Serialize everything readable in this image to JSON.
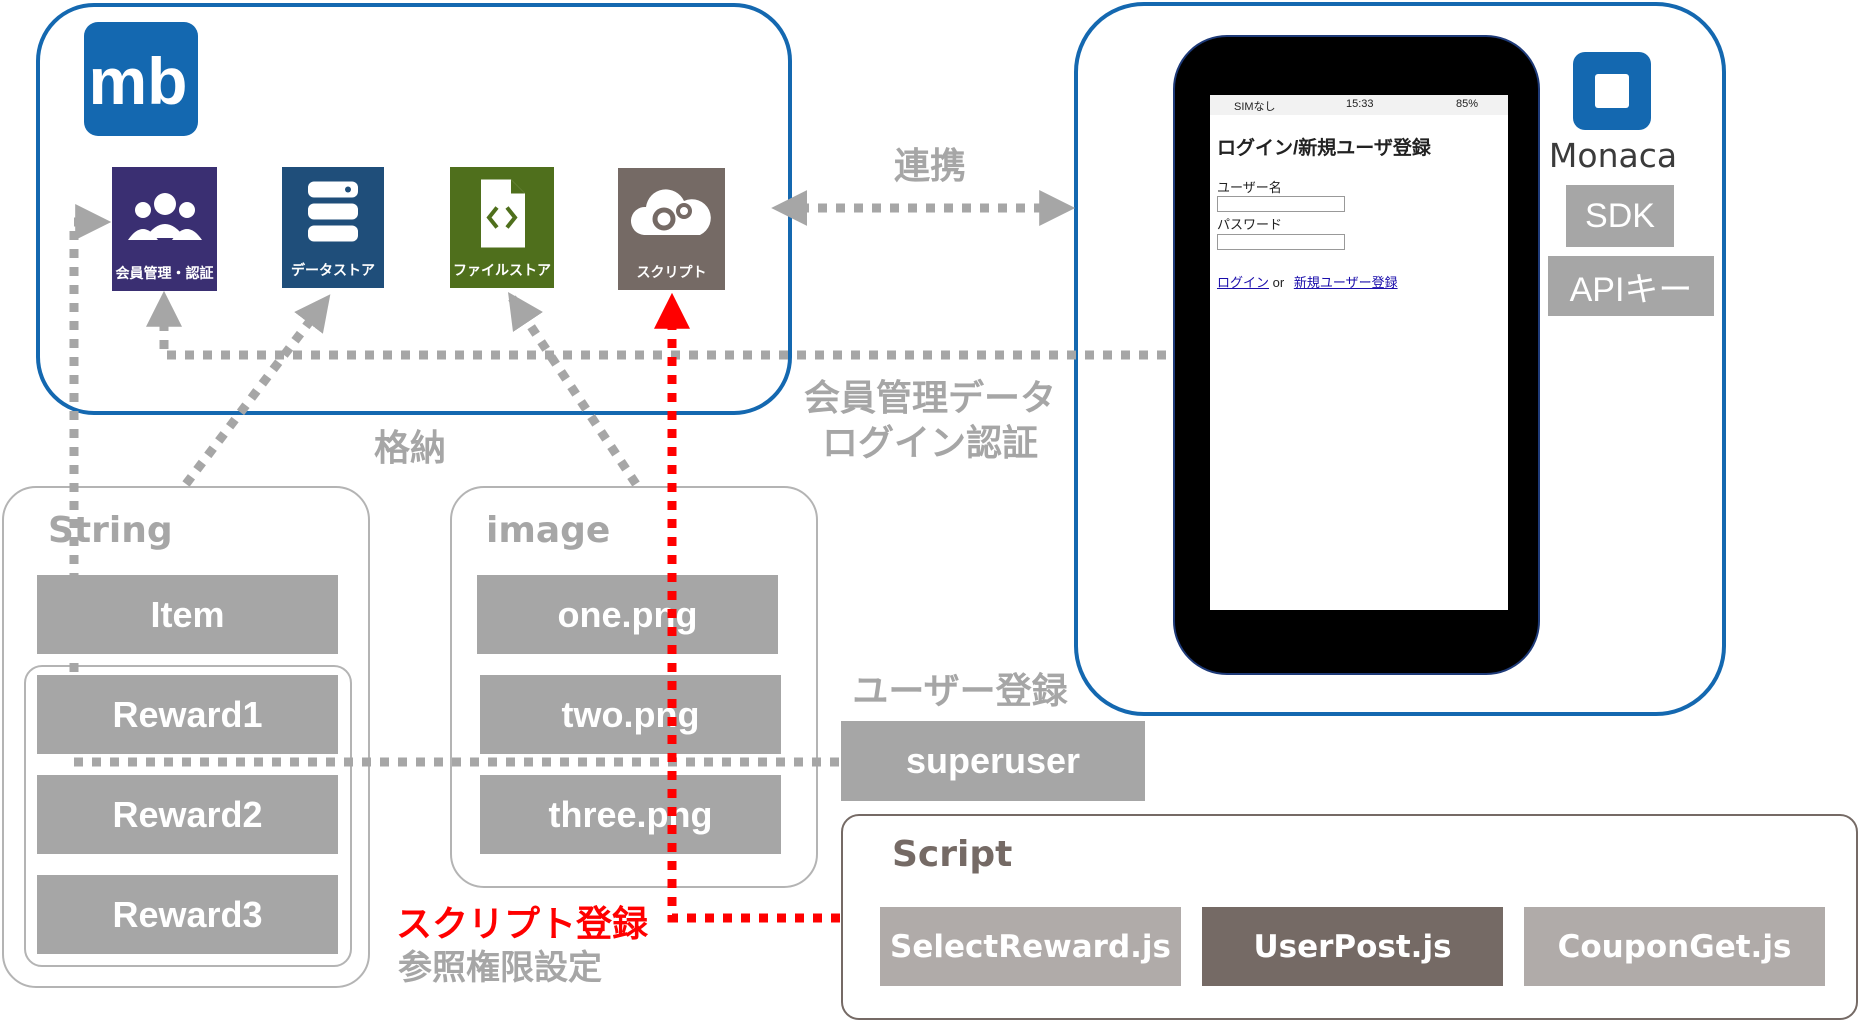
{
  "services": [
    {
      "label": "会員管理・認証",
      "icon": "members-icon",
      "color": "#3a2f72"
    },
    {
      "label": "データストア",
      "icon": "database-icon",
      "color": "#1f4e7a"
    },
    {
      "label": "ファイルストア",
      "icon": "file-code-icon",
      "color": "#4f6f1c"
    },
    {
      "label": "スクリプト",
      "icon": "cloud-gear-icon",
      "color": "#756a65"
    }
  ],
  "labels": {
    "renkei": "連携",
    "member_data_1": "会員管理データ",
    "member_data_2": "ログイン認証",
    "storage": "格納",
    "user_registration": "ユーザー登録",
    "script_registration": "スクリプト登録",
    "permission_setting": "参照権限設定"
  },
  "phone": {
    "carrier": "SIMなし",
    "time": "15:33",
    "battery": "85%",
    "title": "ログイン/新規ユーザ登録",
    "username_label": "ユーザー名",
    "password_label": "パスワード",
    "login_link": "ログイン",
    "or_text": "or",
    "register_link": "新規ユーザー登録"
  },
  "monaca": {
    "brand": "Monaca",
    "sdk": "SDK",
    "api_key": "APIキー"
  },
  "string_group": {
    "title": "String",
    "items": [
      "Item",
      "Reward1",
      "Reward2",
      "Reward3"
    ]
  },
  "image_group": {
    "title": "image",
    "items": [
      "one.png",
      "two.png",
      "three.png"
    ]
  },
  "superuser": "superuser",
  "script_group": {
    "title": "Script",
    "items": [
      "SelectReward.js",
      "UserPost.js",
      "CouponGet.js"
    ]
  },
  "colors": {
    "blue_border": "#1468b0",
    "gray_box": "#a6a6a6",
    "script_highlight": "#756a65",
    "red_arrow": "#ff0000"
  }
}
